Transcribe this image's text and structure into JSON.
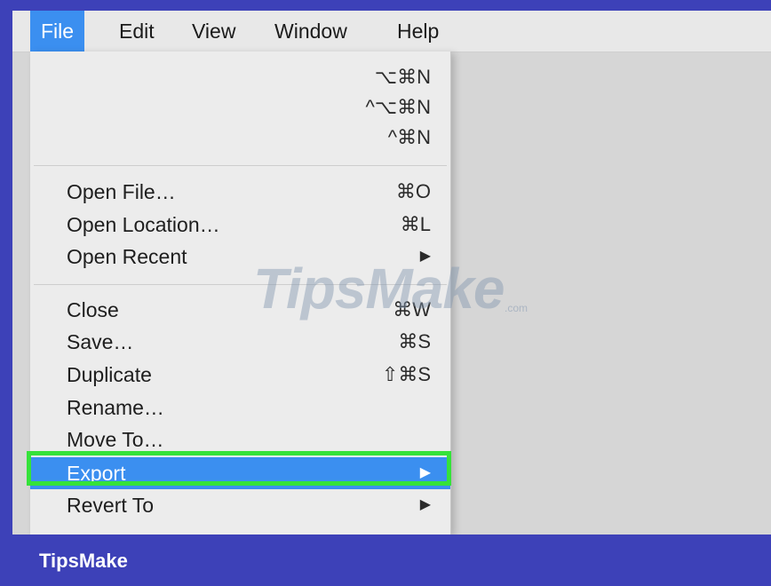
{
  "menubar": {
    "items": [
      {
        "label": "File",
        "active": true
      },
      {
        "label": "Edit"
      },
      {
        "label": "View"
      },
      {
        "label": "Window"
      },
      {
        "label": "Help"
      }
    ]
  },
  "file_menu": {
    "group1": [
      {
        "label": "",
        "shortcut": "⌥⌘N"
      },
      {
        "label": "",
        "shortcut": "^⌥⌘N"
      },
      {
        "label": "",
        "shortcut": "^⌘N"
      }
    ],
    "group2": [
      {
        "label": "Open File…",
        "shortcut": "⌘O"
      },
      {
        "label": "Open Location…",
        "shortcut": "⌘L"
      },
      {
        "label": "Open Recent",
        "shortcut": "▶"
      }
    ],
    "group3": [
      {
        "label": "Close",
        "shortcut": "⌘W"
      },
      {
        "label": "Save…",
        "shortcut": "⌘S"
      },
      {
        "label": "Duplicate",
        "shortcut": "⇧⌘S"
      },
      {
        "label": "Rename…",
        "shortcut": ""
      },
      {
        "label": "Move To…",
        "shortcut": ""
      },
      {
        "label": "Export",
        "shortcut": "▶",
        "highlighted": true
      },
      {
        "label": "Revert To",
        "shortcut": "▶"
      }
    ]
  },
  "watermark": {
    "text": "TipsMake",
    "suffix": ".com"
  },
  "footer": {
    "brand": "TipsMake"
  },
  "colors": {
    "accent": "#3b8ff0",
    "highlight_outline": "#35e23a",
    "frame": "#3d41b8"
  }
}
